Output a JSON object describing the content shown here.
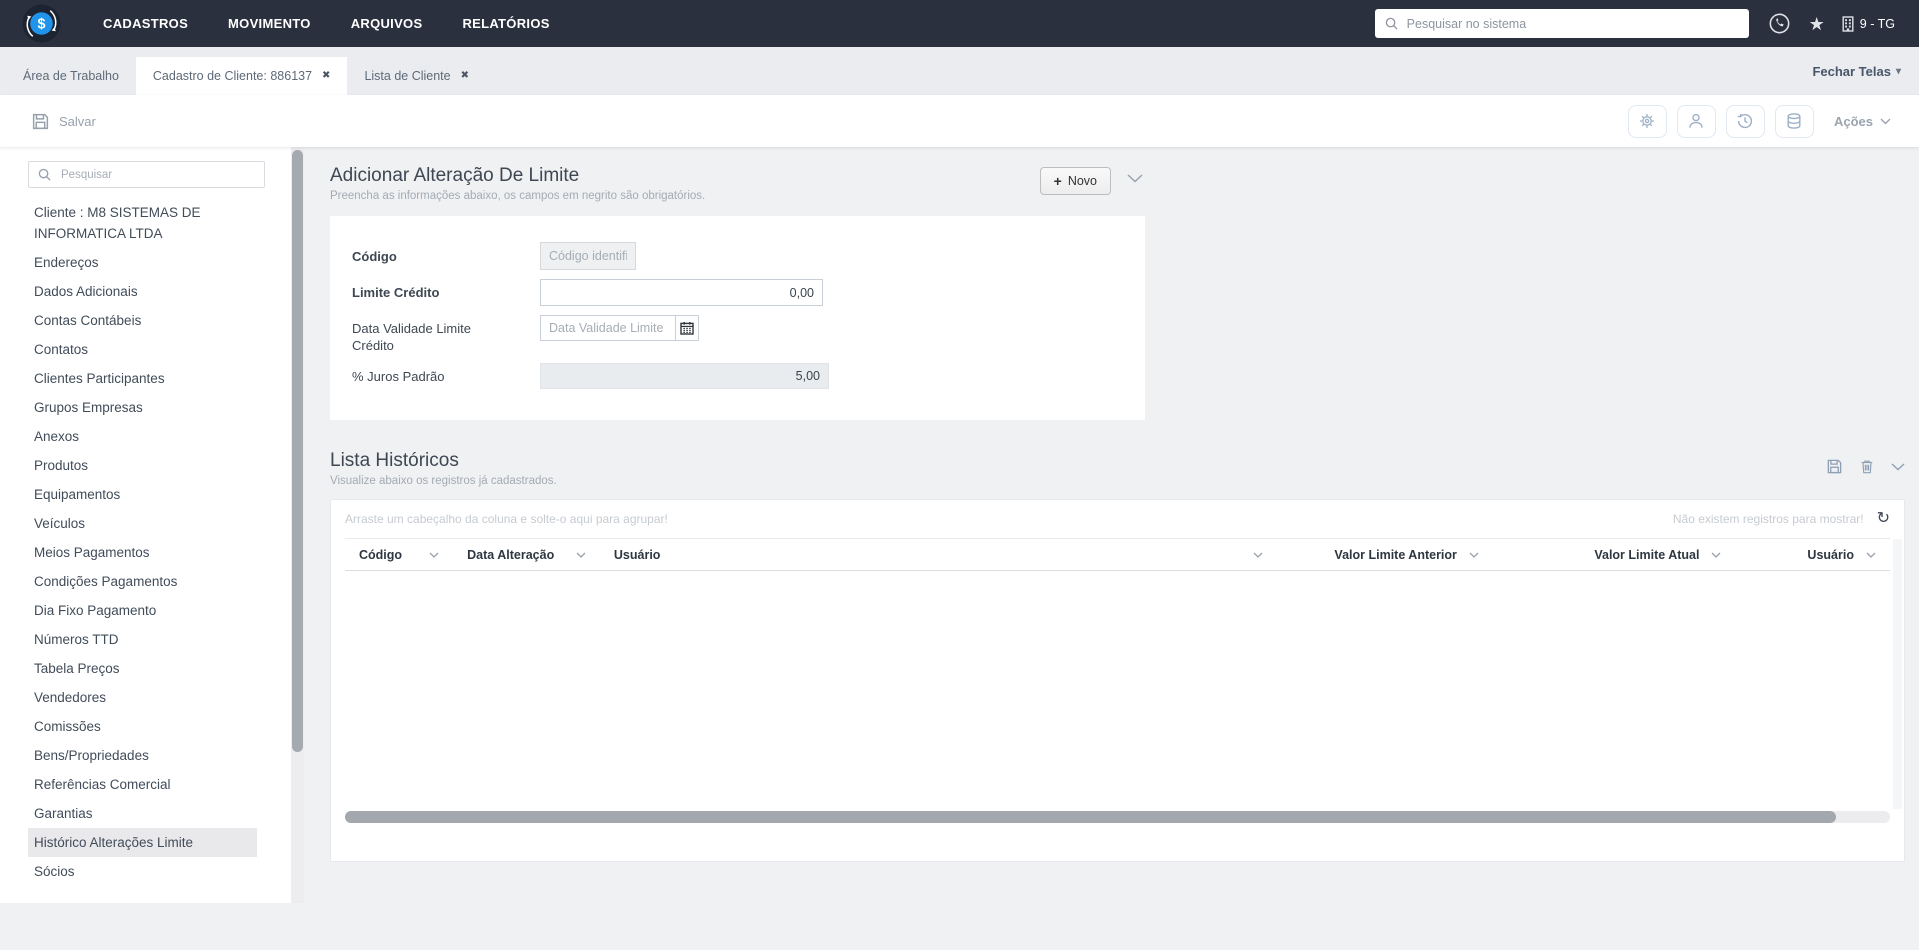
{
  "navbar": {
    "menu": [
      {
        "label": "CADASTROS"
      },
      {
        "label": "MOVIMENTO"
      },
      {
        "label": "ARQUIVOS"
      },
      {
        "label": "RELATÓRIOS"
      }
    ],
    "search_placeholder": "Pesquisar no sistema",
    "icons": [
      "dollar-logo",
      "whatsapp",
      "favorites-star",
      "company-building"
    ],
    "company": "9 - TG"
  },
  "tabbar": {
    "tabs": [
      {
        "label": "Área de Trabalho",
        "active": false,
        "closable": false
      },
      {
        "label": "Cadastro de Cliente: 886137",
        "active": true,
        "closable": true
      },
      {
        "label": "Lista de Cliente",
        "active": false,
        "closable": true
      }
    ],
    "close_screens_label": "Fechar Telas"
  },
  "toolbar": {
    "save_label": "Salvar",
    "icons": [
      "settings",
      "user",
      "history",
      "database"
    ],
    "actions_label": "Ações"
  },
  "sidebar": {
    "search_placeholder": "Pesquisar",
    "items": [
      {
        "label": "Cliente : M8 SISTEMAS DE INFORMATICA LTDA"
      },
      {
        "label": "Endereços"
      },
      {
        "label": "Dados Adicionais"
      },
      {
        "label": "Contas Contábeis"
      },
      {
        "label": "Contatos"
      },
      {
        "label": "Clientes Participantes"
      },
      {
        "label": "Grupos Empresas"
      },
      {
        "label": "Anexos"
      },
      {
        "label": "Produtos"
      },
      {
        "label": "Equipamentos"
      },
      {
        "label": "Veículos"
      },
      {
        "label": "Meios Pagamentos"
      },
      {
        "label": "Condições Pagamentos"
      },
      {
        "label": "Dia Fixo Pagamento"
      },
      {
        "label": "Números TTD"
      },
      {
        "label": "Tabela Preços"
      },
      {
        "label": "Vendedores"
      },
      {
        "label": "Comissões"
      },
      {
        "label": "Bens/Propriedades"
      },
      {
        "label": "Referências Comercial"
      },
      {
        "label": "Garantias"
      },
      {
        "label": "Histórico Alterações Limite",
        "active": true
      },
      {
        "label": "Sócios"
      }
    ]
  },
  "form_section": {
    "title": "Adicionar Alteração De Limite",
    "subtitle": "Preencha as informações abaixo, os campos em negrito são obrigatórios.",
    "new_button_label": "Novo",
    "fields": {
      "codigo": {
        "label": "Código",
        "placeholder": "Código identifica"
      },
      "limite_credito": {
        "label": "Limite Crédito",
        "value": "0,00"
      },
      "data_validade": {
        "label": "Data Validade Limite Crédito",
        "placeholder": "Data Validade Limite Créd"
      },
      "juros_padrao": {
        "label": "% Juros Padrão",
        "value": "5,00"
      }
    }
  },
  "list_section": {
    "title": "Lista Históricos",
    "subtitle": "Visualize abaixo os registros já cadastrados.",
    "group_hint": "Arraste um cabeçalho da coluna e solte-o aqui para agrupar!",
    "empty_message": "Não existem registros para mostrar!",
    "columns": [
      {
        "label": "Código",
        "width": "7%"
      },
      {
        "label": "Data Alteração",
        "width": "9.5%"
      },
      {
        "label": "Usuário",
        "width": "43.8%"
      },
      {
        "label": "Valor Limite Anterior",
        "width": "14%",
        "align": "right"
      },
      {
        "label": "Valor Limite Atual",
        "width": "15.7%",
        "align": "right"
      },
      {
        "label": "Usuário",
        "width": "10%",
        "align": "right"
      }
    ],
    "rows": []
  }
}
